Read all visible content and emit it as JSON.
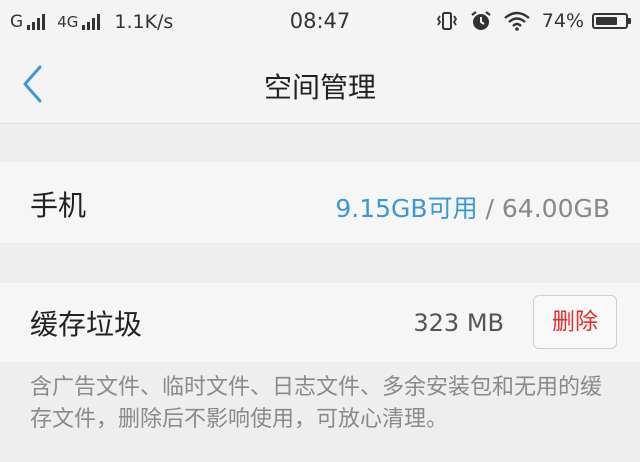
{
  "status_bar": {
    "carrier": "G",
    "network_type": "4G",
    "speed": "1.1K/s",
    "time": "08:47",
    "battery_percent": "74%",
    "battery_level": 0.74,
    "icons": [
      "signal-icon",
      "vibrate-icon",
      "alarm-icon",
      "wifi-icon",
      "battery-icon"
    ]
  },
  "header": {
    "title": "空间管理",
    "back_icon": "chevron-left-icon"
  },
  "phone_storage": {
    "label": "手机",
    "available": "9.15GB可用",
    "separator": " / ",
    "total": "64.00GB"
  },
  "cache": {
    "label": "缓存垃圾",
    "size": "323 MB",
    "delete_label": "删除",
    "description": "含广告文件、临时文件、日志文件、多余安装包和无用的缓存文件，删除后不影响使用，可放心清理。"
  },
  "colors": {
    "accent_blue": "#3a98d8",
    "delete_red": "#e0322c",
    "background": "#eeeeee",
    "card": "#f6f6f6"
  }
}
